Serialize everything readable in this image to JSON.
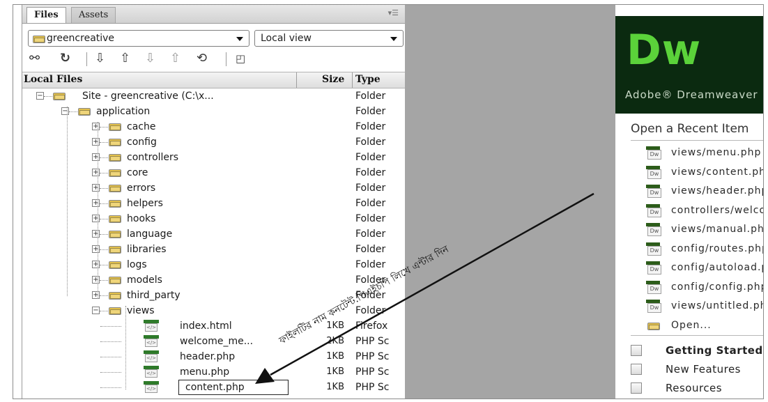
{
  "panel": {
    "tabs": [
      "Files",
      "Assets"
    ],
    "menu_icon": "panel-options-icon",
    "site_dropdown": "greencreative",
    "view_dropdown": "Local view",
    "toolbar_icons": [
      "connect-icon",
      "refresh-icon",
      "get-files-icon",
      "put-files-icon",
      "check-out-icon",
      "check-in-icon",
      "synchronize-icon",
      "expand-icon"
    ],
    "columns": {
      "name": "Local Files",
      "size": "Size",
      "type": "Type"
    }
  },
  "tree": [
    {
      "name": "Site - greencreative (C:\\x...",
      "size": "",
      "type": "Folder",
      "kind": "folder",
      "level": 0,
      "expander": "−"
    },
    {
      "name": "application",
      "size": "",
      "type": "Folder",
      "kind": "folder",
      "level": 1,
      "expander": "−"
    },
    {
      "name": "cache",
      "size": "",
      "type": "Folder",
      "kind": "folder",
      "level": 2,
      "expander": "+"
    },
    {
      "name": "config",
      "size": "",
      "type": "Folder",
      "kind": "folder",
      "level": 2,
      "expander": "+"
    },
    {
      "name": "controllers",
      "size": "",
      "type": "Folder",
      "kind": "folder",
      "level": 2,
      "expander": "+"
    },
    {
      "name": "core",
      "size": "",
      "type": "Folder",
      "kind": "folder",
      "level": 2,
      "expander": "+"
    },
    {
      "name": "errors",
      "size": "",
      "type": "Folder",
      "kind": "folder",
      "level": 2,
      "expander": "+"
    },
    {
      "name": "helpers",
      "size": "",
      "type": "Folder",
      "kind": "folder",
      "level": 2,
      "expander": "+"
    },
    {
      "name": "hooks",
      "size": "",
      "type": "Folder",
      "kind": "folder",
      "level": 2,
      "expander": "+"
    },
    {
      "name": "language",
      "size": "",
      "type": "Folder",
      "kind": "folder",
      "level": 2,
      "expander": "+"
    },
    {
      "name": "libraries",
      "size": "",
      "type": "Folder",
      "kind": "folder",
      "level": 2,
      "expander": "+"
    },
    {
      "name": "logs",
      "size": "",
      "type": "Folder",
      "kind": "folder",
      "level": 2,
      "expander": "+"
    },
    {
      "name": "models",
      "size": "",
      "type": "Folder",
      "kind": "folder",
      "level": 2,
      "expander": "+"
    },
    {
      "name": "third_party",
      "size": "",
      "type": "Folder",
      "kind": "folder",
      "level": 2,
      "expander": "+"
    },
    {
      "name": "views",
      "size": "",
      "type": "Folder",
      "kind": "folder",
      "level": 2,
      "expander": "−"
    },
    {
      "name": "index.html",
      "size": "1KB",
      "type": "Firefox",
      "kind": "file",
      "level": 3
    },
    {
      "name": "welcome_me...",
      "size": "2KB",
      "type": "PHP Sc",
      "kind": "file",
      "level": 3
    },
    {
      "name": "header.php",
      "size": "1KB",
      "type": "PHP Sc",
      "kind": "file",
      "level": 3
    },
    {
      "name": "menu.php",
      "size": "1KB",
      "type": "PHP Sc",
      "kind": "file",
      "level": 3
    },
    {
      "name": "content.php",
      "size": "1KB",
      "type": "PHP Sc",
      "kind": "file",
      "level": 3,
      "editing": true
    }
  ],
  "welcome": {
    "logo": "Dw",
    "product": "Adobe® Dreamweaver",
    "recent_title": "Open a Recent Item",
    "recent_items": [
      "views/menu.php",
      "views/content.php",
      "views/header.php",
      "controllers/welcome.php",
      "views/manual.php",
      "config/routes.php",
      "config/autoload.php",
      "config/config.php",
      "views/untitled.php"
    ],
    "recent_icon_label": "Dw",
    "open_label": "Open...",
    "learn_items": [
      "Getting Started",
      "New Features",
      "Resources"
    ]
  },
  "annotation": {
    "text": "ফাইলটির নাম কনটেন্ট.পিএইচপি লিখে এন্টার দিন"
  }
}
